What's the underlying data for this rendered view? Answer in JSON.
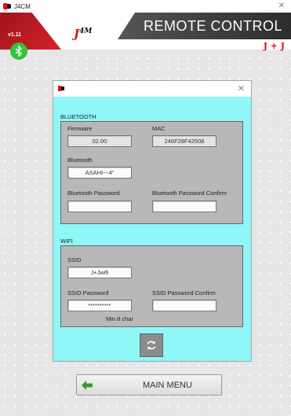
{
  "window": {
    "title": "J4CM"
  },
  "header": {
    "version": "v1.11",
    "title": "REMOTE CONTROL",
    "brand_logo": "J4M",
    "brand_right": "J + J"
  },
  "icons": {
    "bluetooth": "bluetooth-icon",
    "refresh": "refresh-icon",
    "back_arrow": "left-arrow-icon"
  },
  "dialog": {
    "bluetooth_section": "BLUETOOTH",
    "firmware_label": "Firmware",
    "firmware_value": "02.00",
    "mac_label": "MAC",
    "mac_value": "246F28F42508",
    "bluetooth_label": "Bluetooth",
    "bluetooth_value": "ASAHI---4\"",
    "bt_password_label": "Bluetooth Password",
    "bt_password_value": "",
    "bt_password_confirm_label": "Bluetooth Password Confirm",
    "bt_password_confirm_value": "",
    "wifi_section": "WIFI",
    "ssid_label": "SSID",
    "ssid_value": "J+Jwifi",
    "ssid_password_label": "SSID Password",
    "ssid_password_value": "**********",
    "ssid_password_confirm_label": "SSID Password Confirm",
    "ssid_password_confirm_value": "",
    "min_hint": "Min 8 char"
  },
  "main_menu": {
    "label": "MAIN MENU"
  },
  "colors": {
    "header_red": "#d6202a",
    "dialog_bg": "#8ff7f7",
    "group_bg": "#b8b8b8",
    "bluetooth_green": "#36c23a",
    "arrow_green": "#3a9a2e"
  }
}
